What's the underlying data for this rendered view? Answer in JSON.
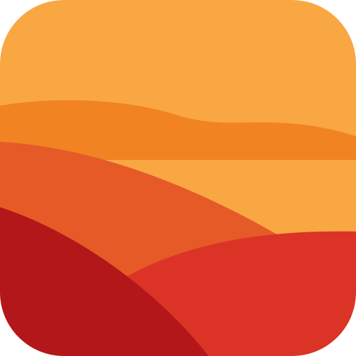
{
  "app_icon": {
    "icon_name": "landscape-hills-icon",
    "colors": {
      "sky": "#F9A743",
      "far_hill": "#F28322",
      "middle_hill": "#E65A27",
      "near_right_hill": "#DC3327",
      "near_left_hill": "#B4171A"
    }
  }
}
